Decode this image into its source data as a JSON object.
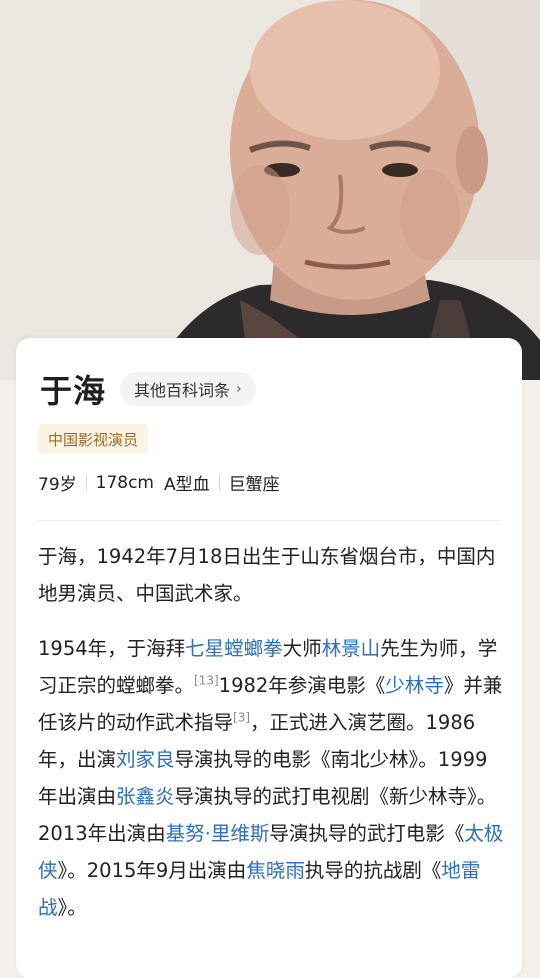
{
  "person": {
    "name": "于海",
    "other_entries_label": "其他百科词条",
    "tag": "中国影视演员",
    "facts": [
      "79岁",
      "178cm",
      "A型血",
      "巨蟹座"
    ]
  },
  "intro": {
    "p1": "于海，1942年7月18日出生于山东省烟台市，中国内地男演员、中国武术家。",
    "p2_segments": [
      "1954年，于海拜",
      "七星螳螂拳",
      "大师",
      "林景山",
      "先生为师，学习正宗的螳螂拳。",
      "[13]",
      "1982年参演电影《",
      "少林寺",
      "》并兼任该片的动作武术指导",
      "[3]",
      "，正式进入演艺圈。1986年，出演",
      "刘家良",
      "导演执导的电影《南北少林》。1999年出演由",
      "张鑫炎",
      "导演执导的武打电视剧《新少林寺》。2013年出演由",
      "基努·里维斯",
      "导演执导的武打电影《",
      "太极侠",
      "》。2015年9月出演由",
      "焦晓雨",
      "执导的抗战剧《",
      "地雷战",
      "》。"
    ]
  },
  "colors": {
    "link": "#2f6fb7",
    "tag_text": "#9a6a2b",
    "tag_bg": "#fbf3e4"
  }
}
